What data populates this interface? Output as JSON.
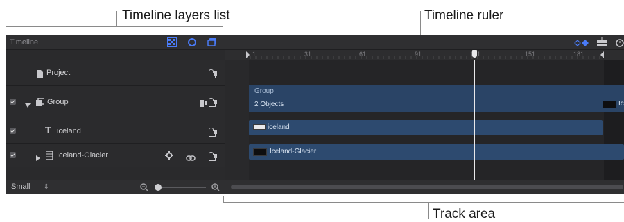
{
  "callouts": {
    "layers_list": "Timeline layers list",
    "ruler": "Timeline ruler",
    "track_area": "Track area"
  },
  "panel": {
    "title": "Timeline",
    "header_icons": [
      "checker-icon",
      "circle-icon",
      "window-stack-icon"
    ],
    "track_header_icons": [
      "keyframe-icon",
      "snap-icon",
      "clock-icon"
    ]
  },
  "ruler": {
    "labels": [
      "1",
      "31",
      "61",
      "91",
      "121",
      "151",
      "181"
    ]
  },
  "layers": [
    {
      "name": "Project",
      "type": "project",
      "checked": false,
      "has_disclosure": false,
      "underlined": false
    },
    {
      "name": "Group",
      "type": "group",
      "checked": true,
      "has_disclosure": true,
      "disclosure": "open",
      "underlined": true
    },
    {
      "name": "iceland",
      "type": "text",
      "checked": true,
      "has_disclosure": false,
      "underlined": false
    },
    {
      "name": "Iceland-Glacier",
      "type": "video",
      "checked": true,
      "has_disclosure": true,
      "disclosure": "closed",
      "underlined": false
    }
  ],
  "tracks": {
    "group_label": "Group",
    "group_sublabel": "2 Objects",
    "iceland_label": "iceland",
    "glacier_label": "Iceland-Glacier",
    "edge_clip_label": "Ic"
  },
  "footer": {
    "size_label": "Small",
    "size_options_icon": "updown-chevron-icon",
    "zoom_level": 0.05
  },
  "colors": {
    "bar": "#2d4a6f",
    "accent": "#4a7bf7",
    "playhead": "#e8e8ea"
  }
}
